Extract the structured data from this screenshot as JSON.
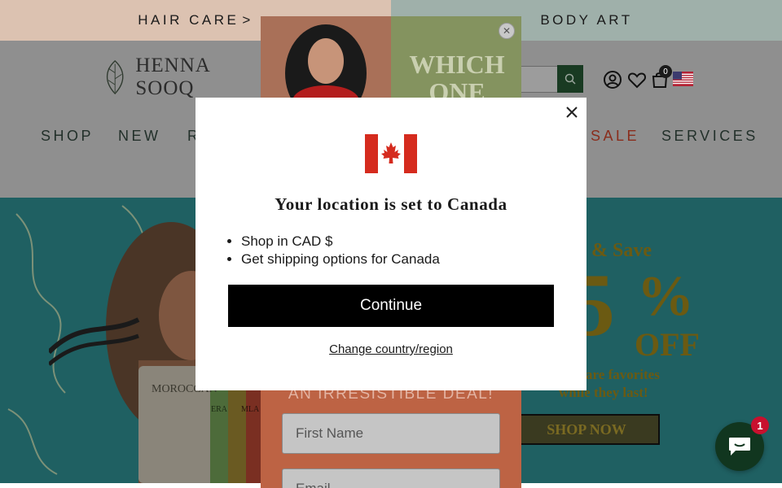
{
  "announcement": {
    "left_text": "HAIR CARE",
    "left_arrow": ">",
    "right_text": "BODY ART"
  },
  "header": {
    "logo_text": "HENNA SOOQ",
    "cart_count": "0",
    "nav": [
      "SHOP",
      "NEW",
      "R",
      "SALE",
      "SERVICES"
    ]
  },
  "hero": {
    "promo_save": "& Save",
    "promo_digit": "5",
    "promo_percent": "%",
    "promo_off": "OFF",
    "promo_line1": "r care favorites",
    "promo_line2": "while they last!",
    "shop_now": "SHOP NOW",
    "product_label_1": "MOROCCAN",
    "product_label_2": "ERA",
    "product_label_3": "MLA"
  },
  "newsletter_popup": {
    "heading_line1": "WHICH",
    "heading_line2": "ONE",
    "deal_text": "AN IRRESISTIBLE DEAL!",
    "first_name_placeholder": "First Name",
    "email_placeholder": "Email"
  },
  "location_modal": {
    "title": "Your location is set to Canada",
    "bullets": [
      "Shop in CAD $",
      "Get shipping options for Canada"
    ],
    "continue_label": "Continue",
    "change_label": "Change country/region"
  },
  "chat": {
    "badge_count": "1"
  },
  "colors": {
    "announce_left": "#dcc2b1",
    "announce_right": "#9fb0aa",
    "brand_green": "#193a22",
    "canada_red": "#d52b1e",
    "chat_green": "#11361f"
  },
  "icons": [
    "search-icon",
    "account-icon",
    "heart-icon",
    "cart-icon",
    "us-flag-icon",
    "close-icon",
    "canada-flag-icon",
    "chat-icon"
  ]
}
